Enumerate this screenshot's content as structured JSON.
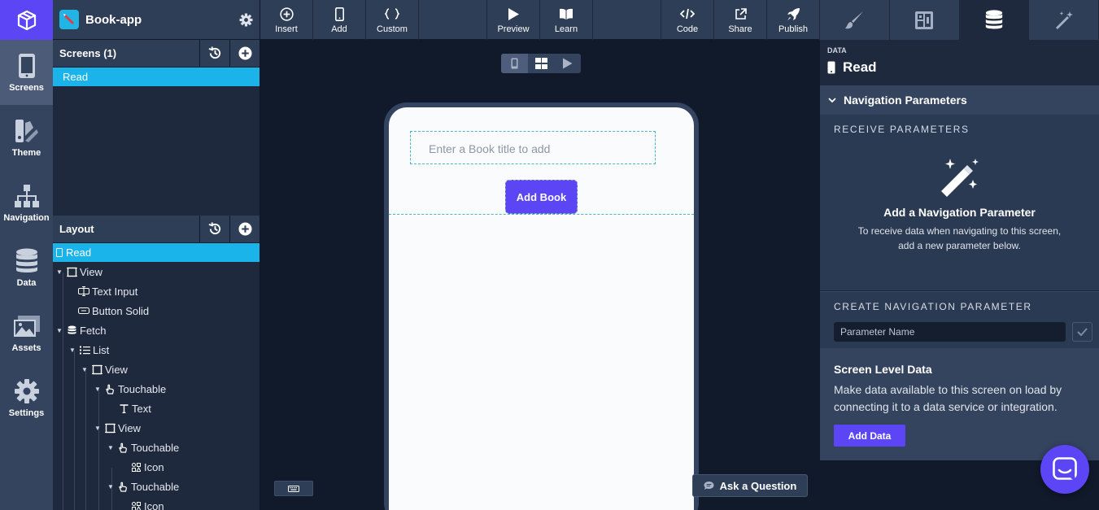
{
  "rail": {
    "items": [
      {
        "label": "Screens",
        "icon": "phone-icon",
        "active": true
      },
      {
        "label": "Theme",
        "icon": "theme-icon",
        "active": false
      },
      {
        "label": "Navigation",
        "icon": "sitemap-icon",
        "active": false
      },
      {
        "label": "Data",
        "icon": "database-icon",
        "active": false
      },
      {
        "label": "Assets",
        "icon": "image-icon",
        "active": false
      },
      {
        "label": "Settings",
        "icon": "gear-icon",
        "active": false
      }
    ]
  },
  "app": {
    "name": "Book-app"
  },
  "screens": {
    "title": "Screens (1)",
    "selected": "Read"
  },
  "layout": {
    "title": "Layout",
    "tree": [
      {
        "label": "Read"
      },
      {
        "label": "View"
      },
      {
        "label": "Text Input"
      },
      {
        "label": "Button Solid"
      },
      {
        "label": "Fetch"
      },
      {
        "label": "List"
      },
      {
        "label": "View"
      },
      {
        "label": "Touchable"
      },
      {
        "label": "Text"
      },
      {
        "label": "View"
      },
      {
        "label": "Touchable"
      },
      {
        "label": "Icon"
      },
      {
        "label": "Touchable"
      },
      {
        "label": "Icon"
      }
    ]
  },
  "toolbar": {
    "insert": "Insert",
    "add": "Add",
    "custom": "Custom",
    "preview": "Preview",
    "learn": "Learn",
    "code": "Code",
    "share": "Share",
    "publish": "Publish"
  },
  "canvas": {
    "input_placeholder": "Enter a Book title to add",
    "button_label": "Add Book",
    "ask_label": "Ask a Question"
  },
  "right": {
    "tabs": [
      "brush-icon",
      "layout-icon",
      "database-icon",
      "magic-wand-icon"
    ],
    "section_label": "DATA",
    "screen_name": "Read",
    "nav_params": "Navigation Parameters",
    "receive_title": "RECEIVE PARAMETERS",
    "add_param_title": "Add a Navigation Parameter",
    "add_param_desc1": "To receive data when navigating to this screen,",
    "add_param_desc2": "add a new parameter below.",
    "create_title": "CREATE NAVIGATION PARAMETER",
    "param_placeholder": "Parameter Name",
    "sld_title": "Screen Level Data",
    "sld_desc": "Make data available to this screen on load by connecting it to a data service or integration.",
    "add_data": "Add Data"
  },
  "colors": {
    "accent": "#5b45f5",
    "selection": "#1ab4ea",
    "panel": "#2f3e57"
  }
}
